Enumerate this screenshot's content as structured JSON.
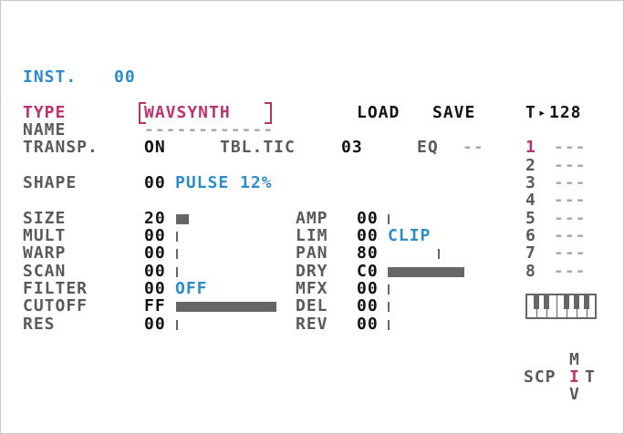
{
  "instrument": {
    "label": "INST.",
    "number": "00"
  },
  "type": {
    "label": "TYPE",
    "value": "WAVSYNTH"
  },
  "file": {
    "load": "LOAD",
    "save": "SAVE"
  },
  "tempo": {
    "label": "T",
    "arrow": "▸",
    "value": "128"
  },
  "name": {
    "label": "NAME",
    "value": "------------"
  },
  "transp": {
    "label": "TRANSP.",
    "value": "ON"
  },
  "tbl_tic": {
    "label": "TBL.TIC",
    "value": "03"
  },
  "eq": {
    "label": "EQ",
    "value": "--"
  },
  "shape": {
    "label": "SHAPE",
    "code": "00",
    "value": "PULSE 12%"
  },
  "params_left": [
    {
      "label": "SIZE",
      "value": "20",
      "level": 0.125
    },
    {
      "label": "MULT",
      "value": "00",
      "level": 0
    },
    {
      "label": "WARP",
      "value": "00",
      "level": 0
    },
    {
      "label": "SCAN",
      "value": "00",
      "level": 0
    },
    {
      "label": "FILTER",
      "value": "00",
      "extra": "OFF"
    },
    {
      "label": "CUTOFF",
      "value": "FF",
      "level": 1.0
    },
    {
      "label": "RES",
      "value": "00",
      "level": 0
    }
  ],
  "params_right": [
    {
      "label": "AMP",
      "value": "00",
      "level": 0
    },
    {
      "label": "LIM",
      "value": "00",
      "extra": "CLIP"
    },
    {
      "label": "PAN",
      "value": "80",
      "level": 0.5
    },
    {
      "label": "DRY",
      "value": "C0",
      "level": 0.75
    },
    {
      "label": "MFX",
      "value": "00",
      "level": 0
    },
    {
      "label": "DEL",
      "value": "00",
      "level": 0
    },
    {
      "label": "REV",
      "value": "00",
      "level": 0
    }
  ],
  "tracks": [
    {
      "num": "1",
      "value": "---",
      "active": true
    },
    {
      "num": "2",
      "value": "---"
    },
    {
      "num": "3",
      "value": "---"
    },
    {
      "num": "4",
      "value": "---"
    },
    {
      "num": "5",
      "value": "---"
    },
    {
      "num": "6",
      "value": "---"
    },
    {
      "num": "7",
      "value": "---"
    },
    {
      "num": "8",
      "value": "---"
    }
  ],
  "nav": {
    "up": "M",
    "row_left": "SCP",
    "current": "I",
    "row_right": "T",
    "down": "V"
  },
  "colors": {
    "accent_blue": "#2d8ccc",
    "accent_pink": "#c0306e",
    "text": "#111111",
    "dim": "#5a5a5a",
    "bar": "#666666"
  }
}
